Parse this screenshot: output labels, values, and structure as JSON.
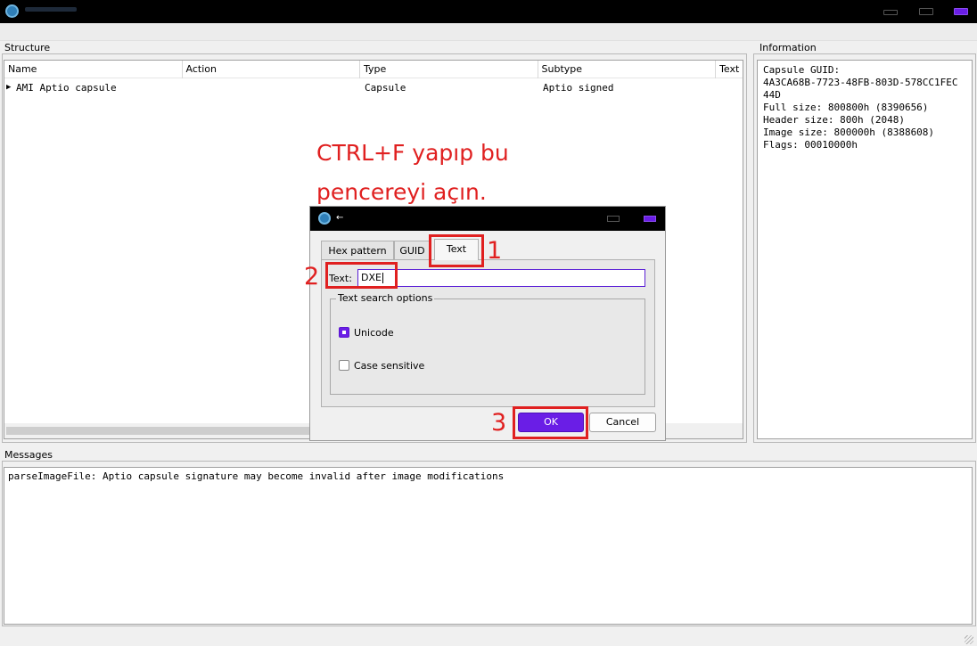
{
  "window": {
    "dialog_title": "←"
  },
  "structure": {
    "group_label": "Structure",
    "columns": [
      "Name",
      "Action",
      "Type",
      "Subtype",
      "Text"
    ],
    "rows": [
      {
        "name": "AMI Aptio capsule",
        "action": "",
        "type": "Capsule",
        "subtype": "Aptio signed",
        "text": ""
      }
    ]
  },
  "information": {
    "group_label": "Information",
    "text": "Capsule GUID:\n4A3CA68B-7723-48FB-803D-578CC1FEC\n44D\nFull size: 800800h (8390656)\nHeader size: 800h (2048)\nImage size: 800000h (8388608)\nFlags: 00010000h"
  },
  "messages": {
    "group_label": "Messages",
    "lines": [
      "parseImageFile: Aptio capsule signature may become invalid after image modifications"
    ]
  },
  "annotation": {
    "instruction": "CTRL+F yapıp bu pencereyi açın.",
    "step1": "1",
    "step2": "2",
    "step3": "3",
    "color": "#e02020"
  },
  "search_dialog": {
    "tabs": [
      {
        "label": "Hex pattern",
        "active": false
      },
      {
        "label": "GUID",
        "active": false
      },
      {
        "label": "Text",
        "active": true
      }
    ],
    "text_label": "Text:",
    "text_value": "DXE",
    "options_label": "Text search options",
    "unicode_label": "Unicode",
    "unicode_checked": true,
    "case_sensitive_label": "Case sensitive",
    "case_sensitive_checked": false,
    "ok_label": "OK",
    "cancel_label": "Cancel",
    "accent_color": "#6a1ee6"
  }
}
